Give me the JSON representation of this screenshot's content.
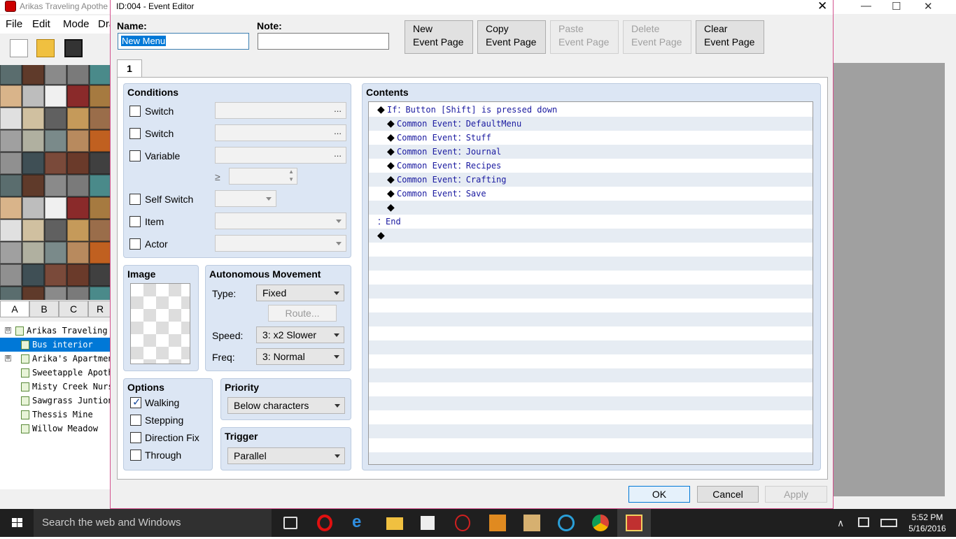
{
  "main_window": {
    "title": "Arikas Traveling Apothe",
    "menu": [
      "File",
      "Edit",
      "Mode",
      "Dra"
    ],
    "tile_tabs": [
      "A",
      "B",
      "C",
      "R"
    ],
    "map_tree": [
      {
        "label": "Arikas Traveling A",
        "selected": false,
        "expand": "⊟"
      },
      {
        "label": "Bus interior",
        "selected": true,
        "expand": ""
      },
      {
        "label": "Arika's Apartment",
        "selected": false,
        "expand": "⊞"
      },
      {
        "label": "Sweetapple Apothe",
        "selected": false,
        "expand": ""
      },
      {
        "label": "Misty Creek Nurs",
        "selected": false,
        "expand": ""
      },
      {
        "label": "Sawgrass Juntion",
        "selected": false,
        "expand": ""
      },
      {
        "label": "Thessis Mine",
        "selected": false,
        "expand": ""
      },
      {
        "label": "Willow Meadow",
        "selected": false,
        "expand": ""
      }
    ]
  },
  "dialog": {
    "title": "ID:004 - Event Editor",
    "name_label": "Name:",
    "name_value": "New Menu",
    "note_label": "Note:",
    "note_value": "",
    "page_buttons": [
      {
        "line1": "New",
        "line2": "Event Page",
        "enabled": true
      },
      {
        "line1": "Copy",
        "line2": "Event Page",
        "enabled": true
      },
      {
        "line1": "Paste",
        "line2": "Event Page",
        "enabled": false
      },
      {
        "line1": "Delete",
        "line2": "Event Page",
        "enabled": false
      },
      {
        "line1": "Clear",
        "line2": "Event Page",
        "enabled": true
      }
    ],
    "page_tab": "1",
    "conditions": {
      "title": "Conditions",
      "rows": [
        {
          "label": "Switch",
          "value": "...",
          "type": "ellipsis"
        },
        {
          "label": "Switch",
          "value": "...",
          "type": "ellipsis"
        },
        {
          "label": "Variable",
          "value": "...",
          "type": "ellipsis"
        },
        {
          "label": "Self Switch",
          "value": "",
          "type": "combo"
        },
        {
          "label": "Item",
          "value": "",
          "type": "combo"
        },
        {
          "label": "Actor",
          "value": "",
          "type": "combo"
        }
      ],
      "gte": "≥"
    },
    "image": {
      "title": "Image"
    },
    "movement": {
      "title": "Autonomous Movement",
      "type_label": "Type:",
      "type_value": "Fixed",
      "route_label": "Route...",
      "speed_label": "Speed:",
      "speed_value": "3: x2 Slower",
      "freq_label": "Freq:",
      "freq_value": "3: Normal"
    },
    "options": {
      "title": "Options",
      "items": [
        {
          "label": "Walking",
          "checked": true
        },
        {
          "label": "Stepping",
          "checked": false
        },
        {
          "label": "Direction Fix",
          "checked": false
        },
        {
          "label": "Through",
          "checked": false
        }
      ]
    },
    "priority": {
      "title": "Priority",
      "value": "Below characters"
    },
    "trigger": {
      "title": "Trigger",
      "value": "Parallel"
    },
    "contents": {
      "title": "Contents",
      "lines": [
        {
          "indent": 0,
          "diamond": true,
          "text": "If：Button [Shift] is pressed down"
        },
        {
          "indent": 1,
          "diamond": true,
          "text": "Common Event：DefaultMenu"
        },
        {
          "indent": 1,
          "diamond": true,
          "text": "Common Event：Stuff"
        },
        {
          "indent": 1,
          "diamond": true,
          "text": "Common Event：Journal"
        },
        {
          "indent": 1,
          "diamond": true,
          "text": "Common Event：Recipes"
        },
        {
          "indent": 1,
          "diamond": true,
          "text": "Common Event：Crafting"
        },
        {
          "indent": 1,
          "diamond": true,
          "text": "Common Event：Save"
        },
        {
          "indent": 1,
          "diamond": true,
          "text": ""
        },
        {
          "indent": 0,
          "diamond": false,
          "text": "：End"
        },
        {
          "indent": 0,
          "diamond": true,
          "text": ""
        }
      ]
    },
    "ok": "OK",
    "cancel": "Cancel",
    "apply": "Apply"
  },
  "taskbar": {
    "search_placeholder": "Search the web and Windows",
    "time": "5:52 PM",
    "date": "5/16/2016"
  }
}
